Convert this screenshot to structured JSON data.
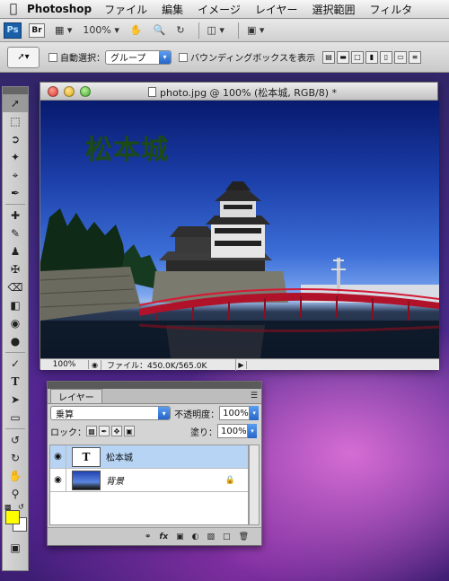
{
  "menubar": {
    "app": "Photoshop",
    "items": [
      "ファイル",
      "編集",
      "イメージ",
      "レイヤー",
      "選択範囲",
      "フィルタ"
    ]
  },
  "appbar": {
    "ps_logo": "Ps",
    "br_logo": "Br",
    "zoom": "100%"
  },
  "options": {
    "auto_select_label": "自動選択：",
    "auto_select_value": "グループ",
    "bbox_label": "バウンディングボックスを表示"
  },
  "document": {
    "title": "photo.jpg @ 100% (松本城, RGB/8) *",
    "text_layer_content": "松本城",
    "zoom": "100%",
    "file_info": "ファイル：450.0K/565.0K"
  },
  "layers_panel": {
    "tab": "レイヤー",
    "blend_mode": "乗算",
    "opacity_label": "不透明度：",
    "opacity": "100%",
    "lock_label": "ロック：",
    "fill_label": "塗り：",
    "fill": "100%",
    "layers": [
      {
        "name": "松本城",
        "thumb": "T",
        "selected": true
      },
      {
        "name": "背景",
        "selected": false
      }
    ]
  },
  "colors": {
    "foreground": "#ffff00",
    "background": "#ffffff",
    "selection": "#b7d4f5",
    "accent": "#2565c8"
  },
  "icons": [
    "apple-icon",
    "move-tool-icon",
    "hand-icon",
    "zoom-icon",
    "rotate-view-icon",
    "eye-icon",
    "lock-icon",
    "link-icon",
    "fx-icon",
    "mask-icon",
    "adjustment-icon",
    "folder-icon",
    "new-layer-icon",
    "trash-icon"
  ]
}
